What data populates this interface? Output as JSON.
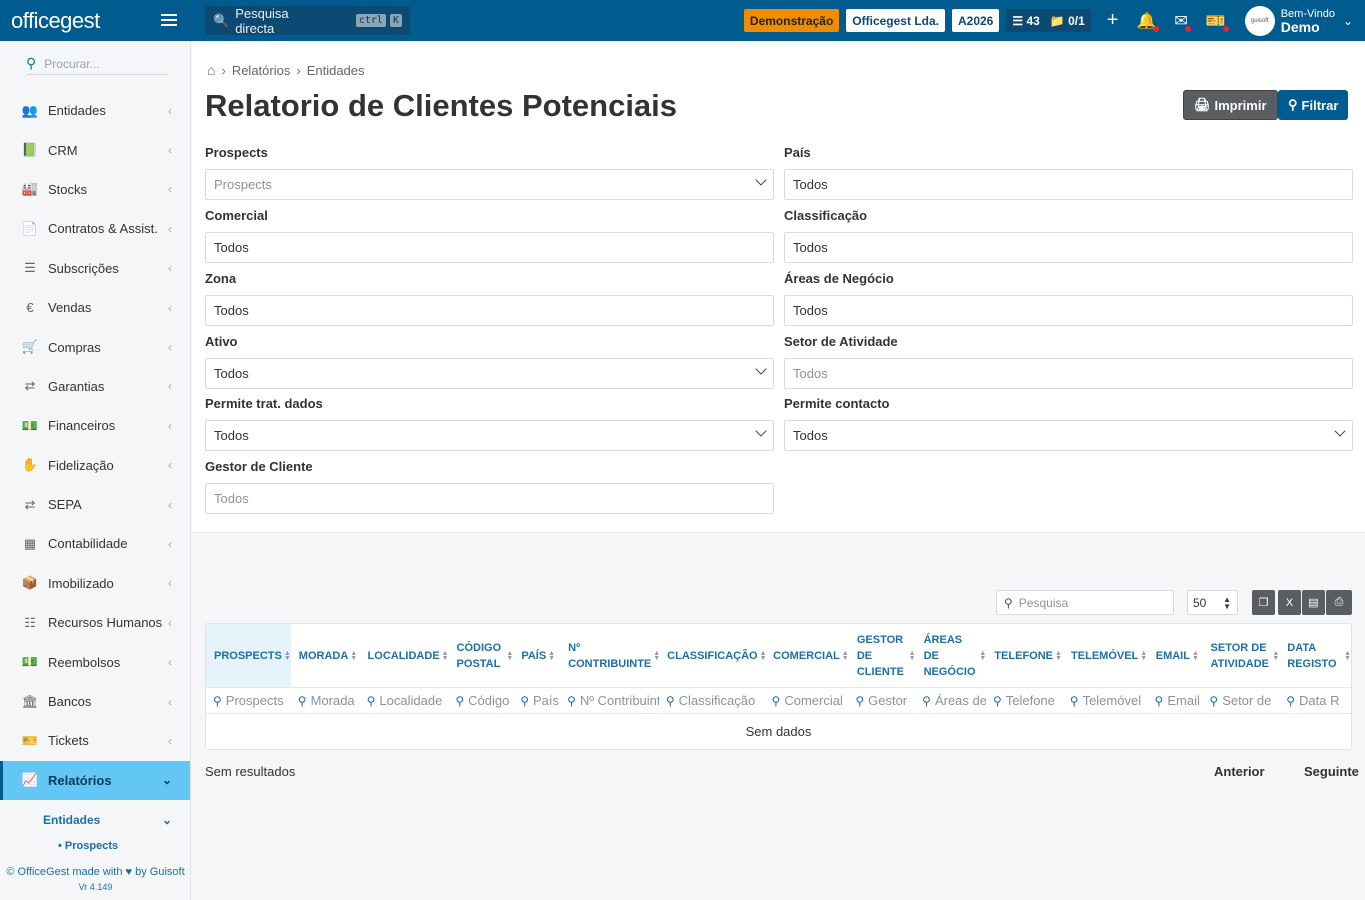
{
  "topbar": {
    "logo": "officegest",
    "search_placeholder": "Pesquisa directa",
    "kbd1": "ctrl",
    "kbd2": "K",
    "badge_demo": "Demonstração",
    "badge_company": "Officegest Lda.",
    "badge_year": "A2026",
    "tasks_count": "43",
    "folders_count": "0/1",
    "user_greeting": "Bem-Vindo",
    "user_name": "Demo"
  },
  "sidebar": {
    "search_placeholder": "Procurar...",
    "items": [
      {
        "label": "Entidades",
        "icon": "users-icon"
      },
      {
        "label": "CRM",
        "icon": "book-icon"
      },
      {
        "label": "Stocks",
        "icon": "warehouse-icon"
      },
      {
        "label": "Contratos & Assist.",
        "icon": "file-contract-icon"
      },
      {
        "label": "Subscrições",
        "icon": "list-icon"
      },
      {
        "label": "Vendas",
        "icon": "euro-icon"
      },
      {
        "label": "Compras",
        "icon": "cart-icon"
      },
      {
        "label": "Garantias",
        "icon": "exchange-icon"
      },
      {
        "label": "Financeiros",
        "icon": "money-icon"
      },
      {
        "label": "Fidelização",
        "icon": "hand-holding-icon"
      },
      {
        "label": "SEPA",
        "icon": "exchange-icon"
      },
      {
        "label": "Contabilidade",
        "icon": "calculator-icon"
      },
      {
        "label": "Imobilizado",
        "icon": "boxes-icon"
      },
      {
        "label": "Recursos Humanos",
        "icon": "sitemap-icon"
      },
      {
        "label": "Reembolsos",
        "icon": "money-bill-icon"
      },
      {
        "label": "Bancos",
        "icon": "bank-icon"
      },
      {
        "label": "Tickets",
        "icon": "ticket-icon"
      },
      {
        "label": "Relatórios",
        "icon": "chart-icon"
      }
    ],
    "sub_item": "Entidades",
    "sub_sub_item": "Prospects",
    "footer": "© OfficeGest made with ♥ by Guisoft",
    "version": "Vr 4.149"
  },
  "breadcrumb": {
    "level1": "Relatórios",
    "level2": "Entidades"
  },
  "page_title": "Relatorio de Clientes Potenciais",
  "buttons": {
    "print": "Imprimir",
    "filter": "Filtrar"
  },
  "filters": {
    "prospects": {
      "label": "Prospects",
      "placeholder": "Prospects"
    },
    "pais": {
      "label": "País",
      "value": "Todos"
    },
    "comercial": {
      "label": "Comercial",
      "value": "Todos"
    },
    "classificacao": {
      "label": "Classificação",
      "value": "Todos"
    },
    "zona": {
      "label": "Zona",
      "value": "Todos"
    },
    "areas": {
      "label": "Áreas de Negócio",
      "value": "Todos"
    },
    "ativo": {
      "label": "Ativo",
      "value": "Todos"
    },
    "setor": {
      "label": "Setor de Atividade",
      "placeholder": "Todos"
    },
    "trat": {
      "label": "Permite trat. dados",
      "value": "Todos"
    },
    "contacto": {
      "label": "Permite contacto",
      "value": "Todos"
    },
    "gestor": {
      "label": "Gestor de Cliente",
      "placeholder": "Todos"
    }
  },
  "table": {
    "search_placeholder": "Pesquisa",
    "page_size": "50",
    "columns": [
      {
        "header": "PROSPECTS",
        "filter": "Prospects"
      },
      {
        "header": "MORADA",
        "filter": "Morada"
      },
      {
        "header": "LOCALIDADE",
        "filter": "Localidade"
      },
      {
        "header": "CÓDIGO POSTAL",
        "filter": "Código"
      },
      {
        "header": "PAÍS",
        "filter": "País"
      },
      {
        "header": "Nº CONTRIBUINTE",
        "filter": "Nº Contribuinte"
      },
      {
        "header": "CLASSIFICAÇÃO",
        "filter": "Classificação"
      },
      {
        "header": "COMERCIAL",
        "filter": "Comercial"
      },
      {
        "header": "GESTOR DE CLIENTE",
        "filter": "Gestor"
      },
      {
        "header": "ÁREAS DE NEGÓCIO",
        "filter": "Áreas de"
      },
      {
        "header": "TELEFONE",
        "filter": "Telefone"
      },
      {
        "header": "TELEMÓVEL",
        "filter": "Telemóvel"
      },
      {
        "header": "EMAIL",
        "filter": "Email"
      },
      {
        "header": "SETOR DE ATIVIDADE",
        "filter": "Setor de"
      },
      {
        "header": "DATA REGISTO",
        "filter": "Data R"
      }
    ],
    "no_data": "Sem dados",
    "no_results": "Sem resultados",
    "prev": "Anterior",
    "next": "Seguinte"
  }
}
